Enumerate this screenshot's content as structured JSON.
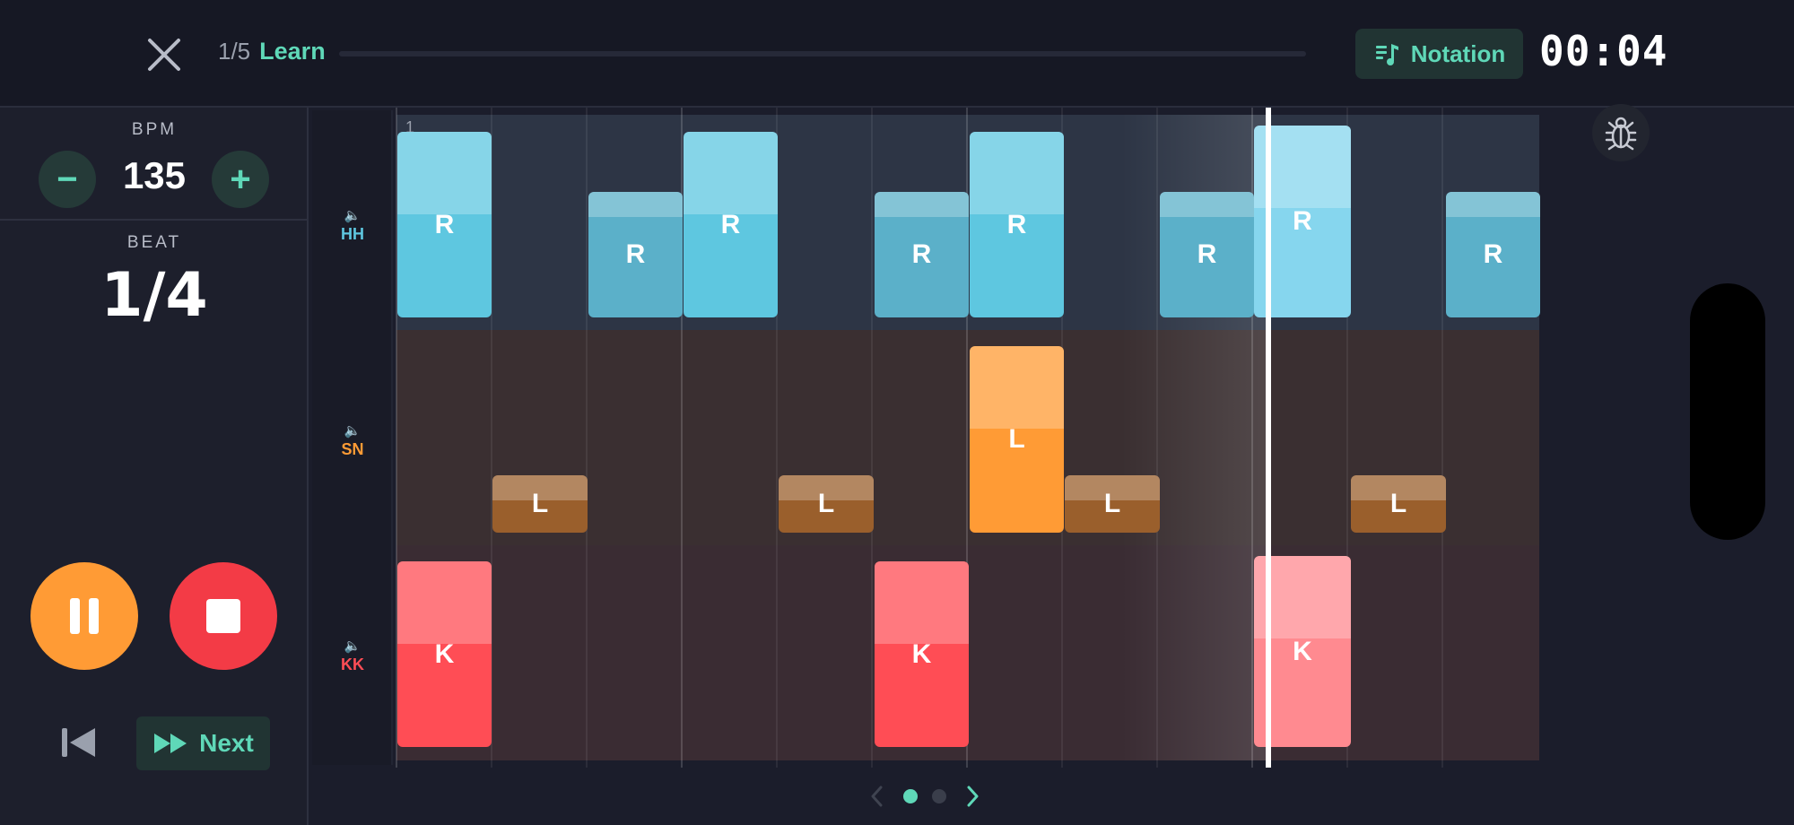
{
  "header": {
    "lesson_index": "1/5",
    "lesson_mode": "Learn",
    "progress": 0,
    "notation_label": "Notation",
    "timer": "00:04"
  },
  "left_panel": {
    "bpm_label": "BPM",
    "bpm_value": "135",
    "minus_symbol": "−",
    "plus_symbol": "+",
    "beat_label": "BEAT",
    "beat_value": "1/4",
    "next_label": "Next"
  },
  "grid": {
    "measure_number": "1",
    "lanes": [
      {
        "id": "hh",
        "label": "HH",
        "color": "#5ec7e0"
      },
      {
        "id": "sn",
        "label": "SN",
        "color": "#ff9b35"
      },
      {
        "id": "kk",
        "label": "KK",
        "color": "#ff4d55"
      }
    ],
    "notes": [
      {
        "lane": "hh",
        "text": "R"
      },
      {
        "lane": "hh",
        "text": "R"
      },
      {
        "lane": "hh",
        "text": "R"
      },
      {
        "lane": "hh",
        "text": "R"
      },
      {
        "lane": "hh",
        "text": "R"
      },
      {
        "lane": "hh",
        "text": "R"
      },
      {
        "lane": "hh",
        "text": "R"
      },
      {
        "lane": "hh",
        "text": "R"
      },
      {
        "lane": "sn",
        "text": "L"
      },
      {
        "lane": "sn",
        "text": "L"
      },
      {
        "lane": "sn",
        "text": "L"
      },
      {
        "lane": "sn",
        "text": "L"
      },
      {
        "lane": "sn",
        "text": "L"
      },
      {
        "lane": "kk",
        "text": "K"
      },
      {
        "lane": "kk",
        "text": "K"
      },
      {
        "lane": "kk",
        "text": "K"
      }
    ]
  },
  "pager": {
    "pages": 2,
    "current": 1
  },
  "colors": {
    "accent": "#5fd8b8",
    "pause": "#ff9b35",
    "stop": "#f33b46",
    "hh": "#5ec7e0",
    "sn": "#ff9b35",
    "kk": "#ff4d55"
  }
}
